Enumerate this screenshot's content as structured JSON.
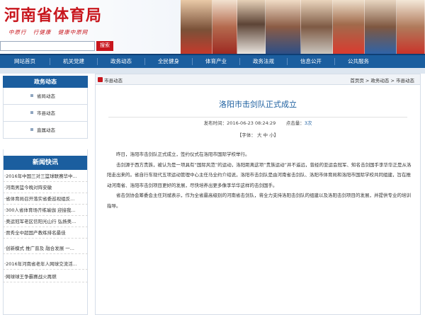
{
  "header": {
    "site_title": "河南省体育局",
    "slogans": [
      "中原行",
      "行健康",
      "健康中原网"
    ],
    "search_button": "搜索",
    "search_placeholder": ""
  },
  "nav": {
    "items": [
      "网站首页",
      "机关党建",
      "政务动态",
      "全民健身",
      "体育产业",
      "政务法规",
      "信息公开",
      "公共服务"
    ]
  },
  "sidebar": {
    "section_title": "政务动态",
    "menu": [
      "省局动态",
      "市县动态",
      "直属动态"
    ],
    "news_title": "新闻快讯",
    "news": [
      "·2016年中国三对三篮球联赛华中...",
      "·河南男篮今晚对阵安徽",
      "·省体育局召开落实省委巡视组反...",
      "·300人省体育场齐练瑜伽 迎接我...",
      "·奥运冠军老区信阳光山行 弘扬奥...",
      "·贾秀全中超国产教练排名最佳",
      "·创新模式 推广普及 融合发展 一...",
      "·2016年河南省老年人网球交流活...",
      "·网球球王争霸赛战火再燃"
    ]
  },
  "breadcrumb": {
    "left": "市县动态",
    "right": "首页页 > 政务动态 > 市县动态"
  },
  "article": {
    "title": "洛阳市击剑队正式成立",
    "publish_label": "发布时间：",
    "publish_time": "2016-06-23 08:24:29",
    "views_label": "点击量：",
    "views": "3次",
    "font_size_label": "【字体： 大  中  小】",
    "paragraphs": [
      "昨日，洛阳市击剑队正式成立，签约仪式在洛阳市国际学校举行。",
      "击剑源于西方贵族，被认为是一项具有“国际风范”的运动，洛阳距离这项“贵族运动”并不遥远，曾经的亚运会冠军、知名击剑国手李华华正是从洛阳走出来的。省自行车现代五项运动管理中心主任马全约介绍说，洛阳市击剑队是由河南省击剑队、洛阳市体育局和洛阳市国际学校共同组建，旨在推动河南省、洛阳市击剑项目更好的发展，尽快培养出更多像李华华这样的击剑国手。",
      "省击剑协会筹委会主任刘斌表示，作为全省最高级别的河南省击剑队，将全力支持洛阳击剑队的组建以及洛阳击剑项目的发展，并提供专业的培训指导。"
    ]
  },
  "colors": {
    "brand_red": "#c8161d",
    "nav_blue": "#1b5e9f",
    "title_blue": "#1b5e9f"
  }
}
